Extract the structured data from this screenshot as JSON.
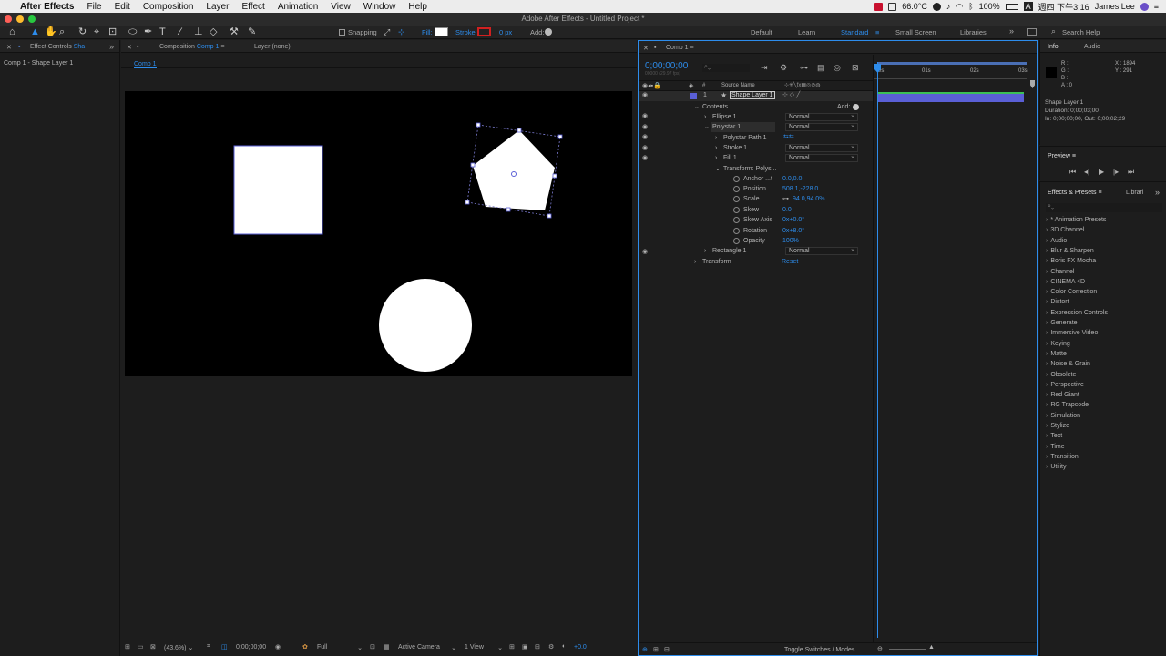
{
  "menubar": {
    "app_name": "After Effects",
    "items": [
      "File",
      "Edit",
      "Composition",
      "Layer",
      "Effect",
      "Animation",
      "View",
      "Window",
      "Help"
    ],
    "temp": "66.0°C",
    "battery": "100%",
    "input_method": "A",
    "clock": "週四 下午3:16",
    "user": "James Lee"
  },
  "window_title": "Adobe After Effects - Untitled Project *",
  "toolbar": {
    "snapping": "Snapping",
    "fill": "Fill:",
    "stroke": "Stroke:",
    "stroke_width": "0 px",
    "add": "Add:",
    "workspaces": [
      "Default",
      "Learn",
      "Standard",
      "Small Screen",
      "Libraries"
    ],
    "active_workspace": "Standard",
    "search_help": "Search Help"
  },
  "left_panel": {
    "tab": "Effect Controls",
    "tab_suffix": "Sha",
    "title": "Comp 1 - Shape Layer 1"
  },
  "comp_panel": {
    "tab": "Composition",
    "tab_name": "Comp 1",
    "layer_tab": "Layer (none)",
    "crumb": "Comp 1",
    "zoom": "(43.6%)",
    "timecode": "0;00;00;00",
    "resolution": "Full",
    "camera": "Active Camera",
    "views": "1 View",
    "exposure": "+0.0"
  },
  "timeline": {
    "tab": "Comp 1",
    "timecode": "0;00;00;00",
    "fps": "00000 (29.97 fps)",
    "header_num": "#",
    "header_source": "Source Name",
    "ruler": [
      "0s",
      "01s",
      "02s",
      "03s"
    ],
    "layer_num": "1",
    "layer_name": "Shape Layer 1",
    "contents": "Contents",
    "add": "Add:",
    "ellipse": "Ellipse 1",
    "polystar": "Polystar 1",
    "polystar_path": "Polystar Path 1",
    "stroke": "Stroke 1",
    "fill": "Fill 1",
    "transform_poly": "Transform: Polys...",
    "anchor_label": "Anchor ...t",
    "anchor_val": "0.0,0.0",
    "position_label": "Position",
    "position_val": "508.1,-228.0",
    "scale_label": "Scale",
    "scale_val": "94.0,94.0%",
    "skew_label": "Skew",
    "skew_val": "0.0",
    "skewaxis_label": "Skew Axis",
    "skewaxis_val": "0x+0.0°",
    "rotation_label": "Rotation",
    "rotation_val": "0x+8.0°",
    "opacity_label": "Opacity",
    "opacity_val": "100%",
    "rectangle": "Rectangle 1",
    "transform": "Transform",
    "reset": "Reset",
    "blend_mode": "Normal",
    "toggle": "Toggle Switches / Modes"
  },
  "info": {
    "tab": "Info",
    "tab2": "Audio",
    "r": "R :",
    "g": "G :",
    "b": "B :",
    "a": "A : 0",
    "x": "X : 1894",
    "y": "Y : 291",
    "layer": "Shape Layer 1",
    "duration": "Duration: 0;00;03;00",
    "inout": "In: 0;00;00;00, Out: 0;00;02;29"
  },
  "preview": {
    "tab": "Preview"
  },
  "effects": {
    "tab": "Effects & Presets",
    "tab2": "Librari",
    "items": [
      "* Animation Presets",
      "3D Channel",
      "Audio",
      "Blur & Sharpen",
      "Boris FX Mocha",
      "Channel",
      "CINEMA 4D",
      "Color Correction",
      "Distort",
      "Expression Controls",
      "Generate",
      "Immersive Video",
      "Keying",
      "Matte",
      "Noise & Grain",
      "Obsolete",
      "Perspective",
      "Red Giant",
      "RG Trapcode",
      "Simulation",
      "Stylize",
      "Text",
      "Time",
      "Transition",
      "Utility"
    ]
  },
  "colors": {
    "accent": "#2d8ceb",
    "layer_bar": "#5a5fd6",
    "stroke_swatch": "#d02020"
  }
}
